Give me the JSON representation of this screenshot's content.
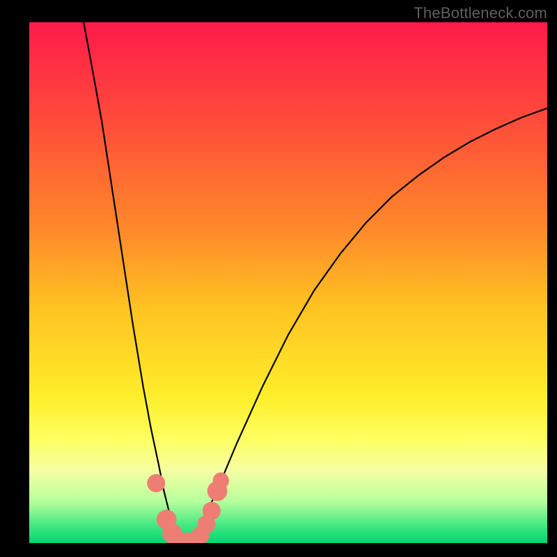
{
  "watermark": "TheBottleneck.com",
  "chart_data": {
    "type": "line",
    "title": "",
    "xlabel": "",
    "ylabel": "",
    "xlim": [
      0,
      100
    ],
    "ylim": [
      0,
      100
    ],
    "gradient_stops": [
      {
        "offset": 0.0,
        "color": "#ff1a4b"
      },
      {
        "offset": 0.2,
        "color": "#ff4f39"
      },
      {
        "offset": 0.4,
        "color": "#ff8a2a"
      },
      {
        "offset": 0.55,
        "color": "#ffc322"
      },
      {
        "offset": 0.72,
        "color": "#ffee2a"
      },
      {
        "offset": 0.8,
        "color": "#fdff61"
      },
      {
        "offset": 0.86,
        "color": "#f6ffa2"
      },
      {
        "offset": 0.92,
        "color": "#b8ff9d"
      },
      {
        "offset": 0.965,
        "color": "#46e882"
      },
      {
        "offset": 1.0,
        "color": "#00d673"
      }
    ],
    "series": [
      {
        "name": "left-branch",
        "x": [
          10.5,
          12,
          14,
          16,
          18,
          20,
          22,
          23.5,
          25,
          26,
          27,
          27.8,
          28.6,
          29.2,
          29.8
        ],
        "y": [
          100,
          92,
          81,
          68,
          55,
          42,
          30,
          22,
          15,
          10,
          6,
          3.5,
          1.8,
          0.8,
          0
        ]
      },
      {
        "name": "right-branch",
        "x": [
          29.8,
          31,
          33,
          36,
          40,
          45,
          50,
          55,
          60,
          65,
          70,
          75,
          80,
          85,
          90,
          95,
          100
        ],
        "y": [
          0,
          0.8,
          3.4,
          9.5,
          19,
          30,
          40,
          48.5,
          55.5,
          61.5,
          66.5,
          70.5,
          74,
          77,
          79.5,
          81.7,
          83.5
        ]
      }
    ],
    "scatter": {
      "name": "points",
      "color": "#ee7e74",
      "points": [
        {
          "x": 24.5,
          "y": 11.5,
          "r": 1.2
        },
        {
          "x": 26.5,
          "y": 4.5,
          "r": 1.4
        },
        {
          "x": 27.6,
          "y": 1.8,
          "r": 1.4
        },
        {
          "x": 28.8,
          "y": 0.5,
          "r": 1.2
        },
        {
          "x": 30.5,
          "y": 0.3,
          "r": 1.2
        },
        {
          "x": 32.0,
          "y": 0.4,
          "r": 1.2
        },
        {
          "x": 33.0,
          "y": 1.4,
          "r": 1.2
        },
        {
          "x": 34.2,
          "y": 3.6,
          "r": 1.2
        },
        {
          "x": 35.2,
          "y": 6.2,
          "r": 1.2
        },
        {
          "x": 36.3,
          "y": 10.0,
          "r": 1.4
        },
        {
          "x": 37.0,
          "y": 12.0,
          "r": 1.0
        }
      ]
    }
  }
}
